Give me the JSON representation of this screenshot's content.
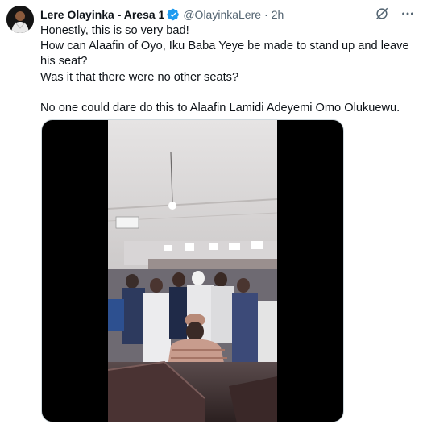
{
  "author": {
    "name": "Lere Olayinka - Aresa 1",
    "handle": "@OlayinkaLere",
    "separator": "·",
    "time": "2h"
  },
  "tweet": {
    "lines": [
      "Honestly,  this is so very bad!",
      "How can Alaafin of Oyo, Iku Baba Yeye be made to stand up and leave his seat?",
      "Was it that there were no other seats?",
      "No one could dare do this to Alaafin Lamidi Adeyemi Omo Olukuewu."
    ]
  },
  "icons": {
    "verified": "verified-badge-icon",
    "grok": "grok-icon",
    "more": "more-options-icon"
  },
  "colors": {
    "verified": "#1d9bf0",
    "text": "#0f1419",
    "muted": "#536471"
  }
}
